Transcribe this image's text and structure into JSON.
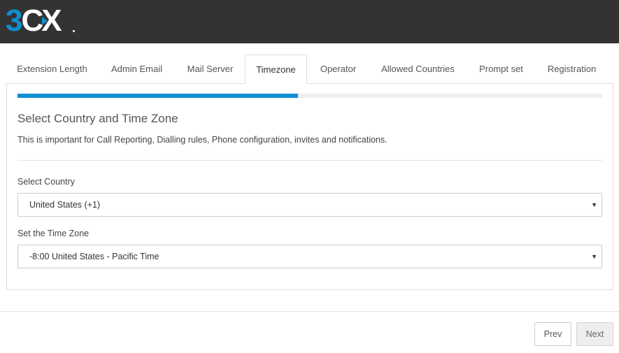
{
  "brand": {
    "logo_primary": "3",
    "logo_secondary": "CX",
    "accent_color": "#0e8fd1",
    "header_color": "#333333"
  },
  "tabs": [
    {
      "label": "Extension Length",
      "active": false
    },
    {
      "label": "Admin Email",
      "active": false
    },
    {
      "label": "Mail Server",
      "active": false
    },
    {
      "label": "Timezone",
      "active": true
    },
    {
      "label": "Operator",
      "active": false
    },
    {
      "label": "Allowed Countries",
      "active": false
    },
    {
      "label": "Prompt set",
      "active": false
    },
    {
      "label": "Registration",
      "active": false
    }
  ],
  "wizard": {
    "progress_percent": 48,
    "title": "Select Country and Time Zone",
    "description": "This is important for Call Reporting, Dialling rules, Phone configuration, invites and notifications.",
    "country": {
      "label": "Select Country",
      "value": "United States (+1)"
    },
    "timezone": {
      "label": "Set the Time Zone",
      "value": "-8:00 United States - Pacific Time"
    }
  },
  "footer": {
    "prev_label": "Prev",
    "next_label": "Next"
  }
}
